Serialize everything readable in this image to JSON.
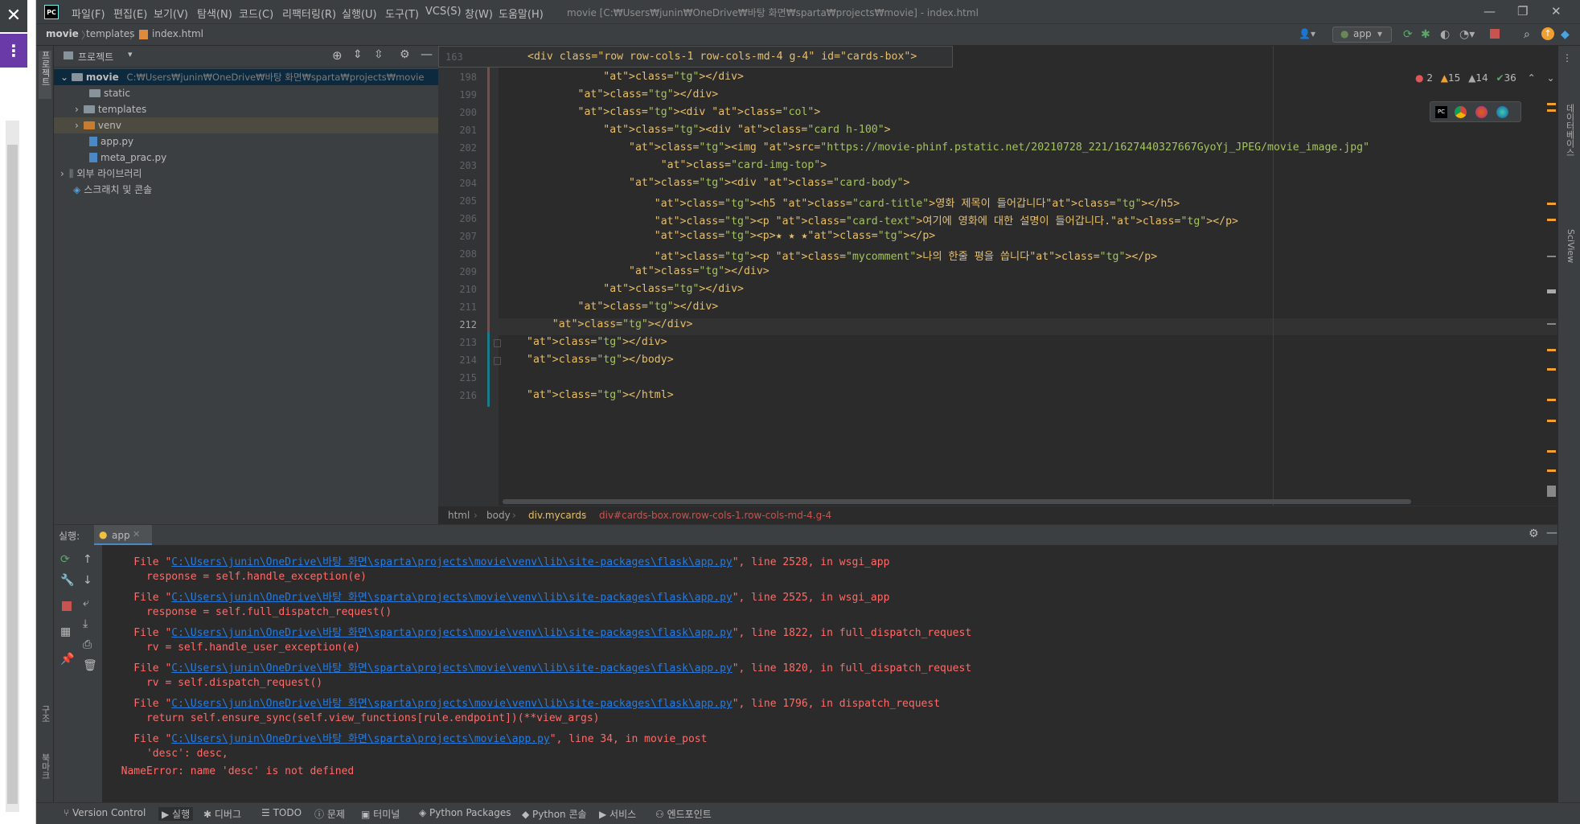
{
  "menu": [
    "파일(F)",
    "편집(E)",
    "보기(V)",
    "탐색(N)",
    "코드(C)",
    "리팩터링(R)",
    "실행(U)",
    "도구(T)",
    "VCS(S)",
    "창(W)",
    "도움말(H)"
  ],
  "window_title": "movie [C:₩Users₩junin₩OneDrive₩바탕 화면₩sparta₩projects₩movie] - index.html",
  "nav": {
    "project": "movie",
    "folder": "templates",
    "file": "index.html",
    "run_config": "app"
  },
  "project_panel": {
    "title": "프로젝트",
    "root": "movie",
    "root_path": "C:₩Users₩junin₩OneDrive₩바탕 화면₩sparta₩projects₩movie",
    "items": [
      "static",
      "templates",
      "venv",
      "app.py",
      "meta_prac.py"
    ],
    "external": "외부 라이브러리",
    "scratch": "스크래치 및 콘솔"
  },
  "editor": {
    "sticky_line": "163",
    "sticky_code": "<div class=\"row row-cols-1 row-cols-md-4 g-4\" id=\"cards-box\">",
    "line_numbers": [
      "198",
      "199",
      "200",
      "201",
      "202",
      "203",
      "204",
      "205",
      "206",
      "207",
      "208",
      "209",
      "210",
      "211",
      "212",
      "213",
      "214",
      "215",
      "216"
    ],
    "lines": [
      "            </div>",
      "        </div>",
      "        <div class=\"col\">",
      "            <div class=\"card h-100\">",
      "                <img src=\"https://movie-phinf.pstatic.net/20210728_221/1627440327667GyoYj_JPEG/movie_image.jpg\"",
      "                     class=\"card-img-top\">",
      "                <div class=\"card-body\">",
      "                    <h5 class=\"card-title\">영화 제목이 들어갑니다</h5>",
      "                    <p class=\"card-text\">여기에 영화에 대한 설명이 들어갑니다.</p>",
      "                    <p>★ ★ ★</p>",
      "                    <p class=\"mycomment\">나의 한줄 평을 씁니다</p>",
      "                </div>",
      "            </div>",
      "        </div>",
      "    </div>",
      "</div>",
      "</body>",
      "",
      "</html>"
    ],
    "inspections": {
      "errors": "2",
      "warnings": "15",
      "weak": "14",
      "typos": "36"
    },
    "breadcrumb": [
      "html",
      "body",
      "div.mycards",
      "div#cards-box.row.row-cols-1.row-cols-md-4.g-4"
    ]
  },
  "run_panel": {
    "label": "실행:",
    "tab": "app",
    "output": [
      {
        "pre": "    File \"",
        "link": "C:\\Users\\junin\\OneDrive\\바탕 화면\\sparta\\projects\\movie\\venv\\lib\\site-packages\\flask\\app.py",
        "post": "\", line 2528, in wsgi_app"
      },
      {
        "pre": "      response = self.handle_exception(e)",
        "link": "",
        "post": ""
      },
      {
        "pre": "    File \"",
        "link": "C:\\Users\\junin\\OneDrive\\바탕 화면\\sparta\\projects\\movie\\venv\\lib\\site-packages\\flask\\app.py",
        "post": "\", line 2525, in wsgi_app"
      },
      {
        "pre": "      response = self.full_dispatch_request()",
        "link": "",
        "post": ""
      },
      {
        "pre": "    File \"",
        "link": "C:\\Users\\junin\\OneDrive\\바탕 화면\\sparta\\projects\\movie\\venv\\lib\\site-packages\\flask\\app.py",
        "post": "\", line 1822, in full_dispatch_request"
      },
      {
        "pre": "      rv = self.handle_user_exception(e)",
        "link": "",
        "post": ""
      },
      {
        "pre": "    File \"",
        "link": "C:\\Users\\junin\\OneDrive\\바탕 화면\\sparta\\projects\\movie\\venv\\lib\\site-packages\\flask\\app.py",
        "post": "\", line 1820, in full_dispatch_request"
      },
      {
        "pre": "      rv = self.dispatch_request()",
        "link": "",
        "post": ""
      },
      {
        "pre": "    File \"",
        "link": "C:\\Users\\junin\\OneDrive\\바탕 화면\\sparta\\projects\\movie\\venv\\lib\\site-packages\\flask\\app.py",
        "post": "\", line 1796, in dispatch_request"
      },
      {
        "pre": "      return self.ensure_sync(self.view_functions[rule.endpoint])(**view_args)",
        "link": "",
        "post": ""
      },
      {
        "pre": "    File \"",
        "link": "C:\\Users\\junin\\OneDrive\\바탕 화면\\sparta\\projects\\movie\\app.py",
        "post": "\", line 34, in movie_post"
      },
      {
        "pre": "      'desc': desc,",
        "link": "",
        "post": ""
      },
      {
        "pre": "  NameError: name 'desc' is not defined",
        "link": "",
        "post": ""
      }
    ]
  },
  "statusbar": [
    "Version Control",
    "실행",
    "디버그",
    "TODO",
    "문제",
    "터미널",
    "Python Packages",
    "Python 콘솔",
    "서비스",
    "엔드포인트"
  ],
  "side_labels": {
    "left_top": "프로젝트",
    "left_structure": "구조",
    "left_bookmarks": "북마크",
    "right_db": "데이터베이스",
    "right_sciview": "SciView"
  }
}
